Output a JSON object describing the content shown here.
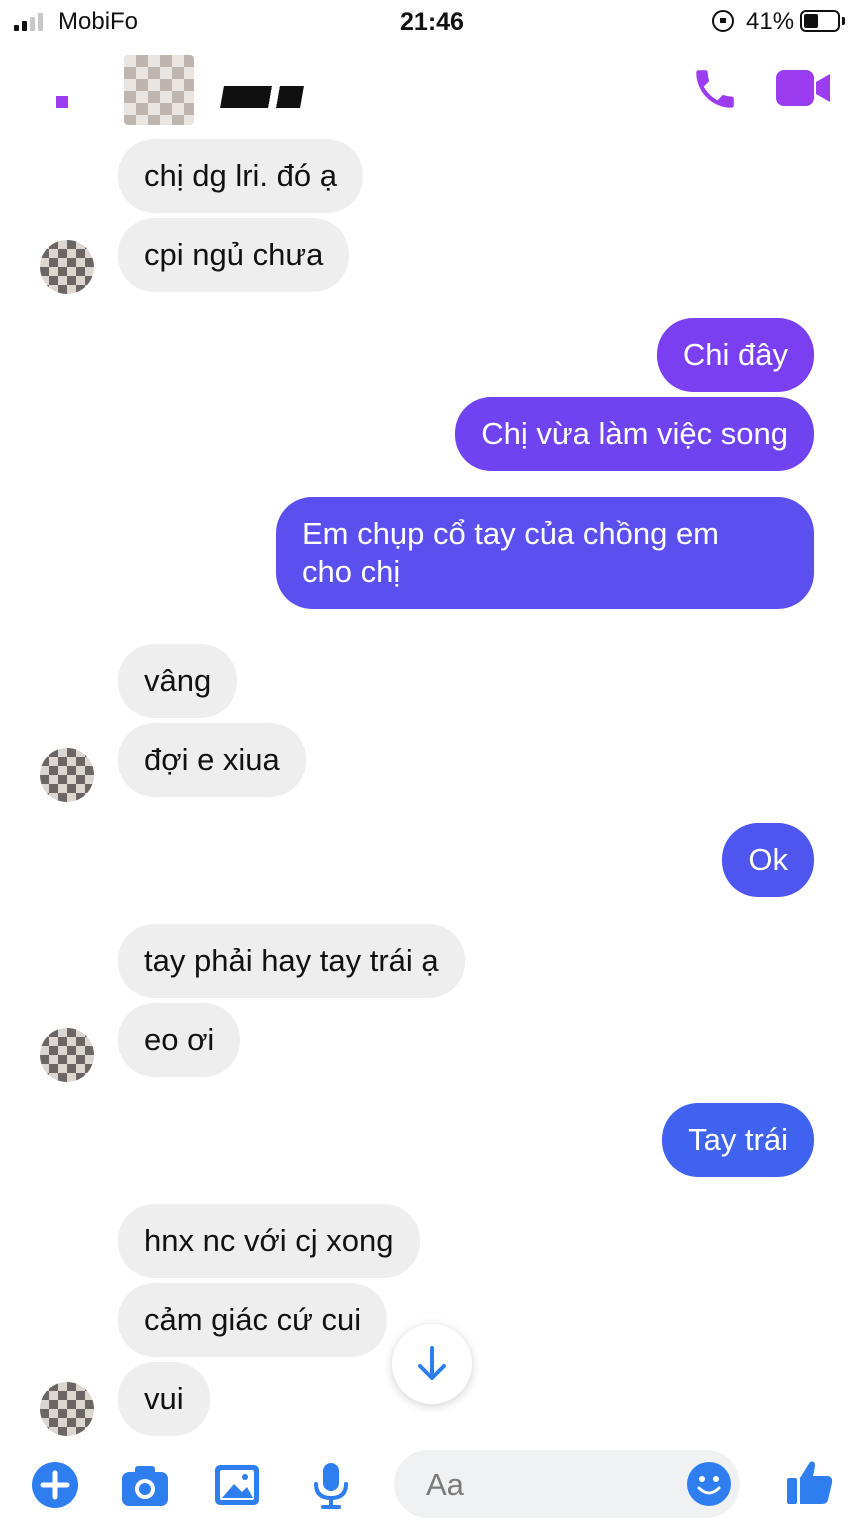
{
  "status_bar": {
    "carrier": "MobiFo",
    "time": "21:46",
    "battery": "41%"
  },
  "header": {
    "call_icon": "phone-icon",
    "video_icon": "video-camera-icon"
  },
  "messages": [
    {
      "side": "in",
      "text": "chị dg lri. đó ạ"
    },
    {
      "side": "in",
      "text": "cpi ngủ chưa"
    },
    {
      "side": "out",
      "text": "Chi đây"
    },
    {
      "side": "out",
      "text": "Chị vừa làm việc song"
    },
    {
      "side": "out",
      "text_line1": "Em chụp cổ tay của chồng em",
      "text_line2": "cho chị"
    },
    {
      "side": "in",
      "text": "vâng"
    },
    {
      "side": "in",
      "text": "đợi e xiua"
    },
    {
      "side": "out",
      "text": "Ok"
    },
    {
      "side": "in",
      "text": "tay phải hay tay trái ạ"
    },
    {
      "side": "in",
      "text": "eo ơi"
    },
    {
      "side": "out",
      "text": "Tay trái"
    },
    {
      "side": "in",
      "text": "hnx nc với cj xong"
    },
    {
      "side": "in",
      "text": "cảm giác cứ cui"
    },
    {
      "side": "in",
      "text": "vui"
    }
  ],
  "composer": {
    "placeholder": "Aa",
    "icons": [
      "plus-icon",
      "camera-icon",
      "image-icon",
      "microphone-icon",
      "emoji-icon",
      "thumbs-up-icon"
    ]
  },
  "colors": {
    "accent": "#9b3cf0",
    "out_purple": "#7a3ff0",
    "out_indigo": "#5b4ff0",
    "out_blue": "#3f63ee",
    "composer_blue": "#2f7ef0",
    "incoming_bg": "#eeeeee"
  }
}
